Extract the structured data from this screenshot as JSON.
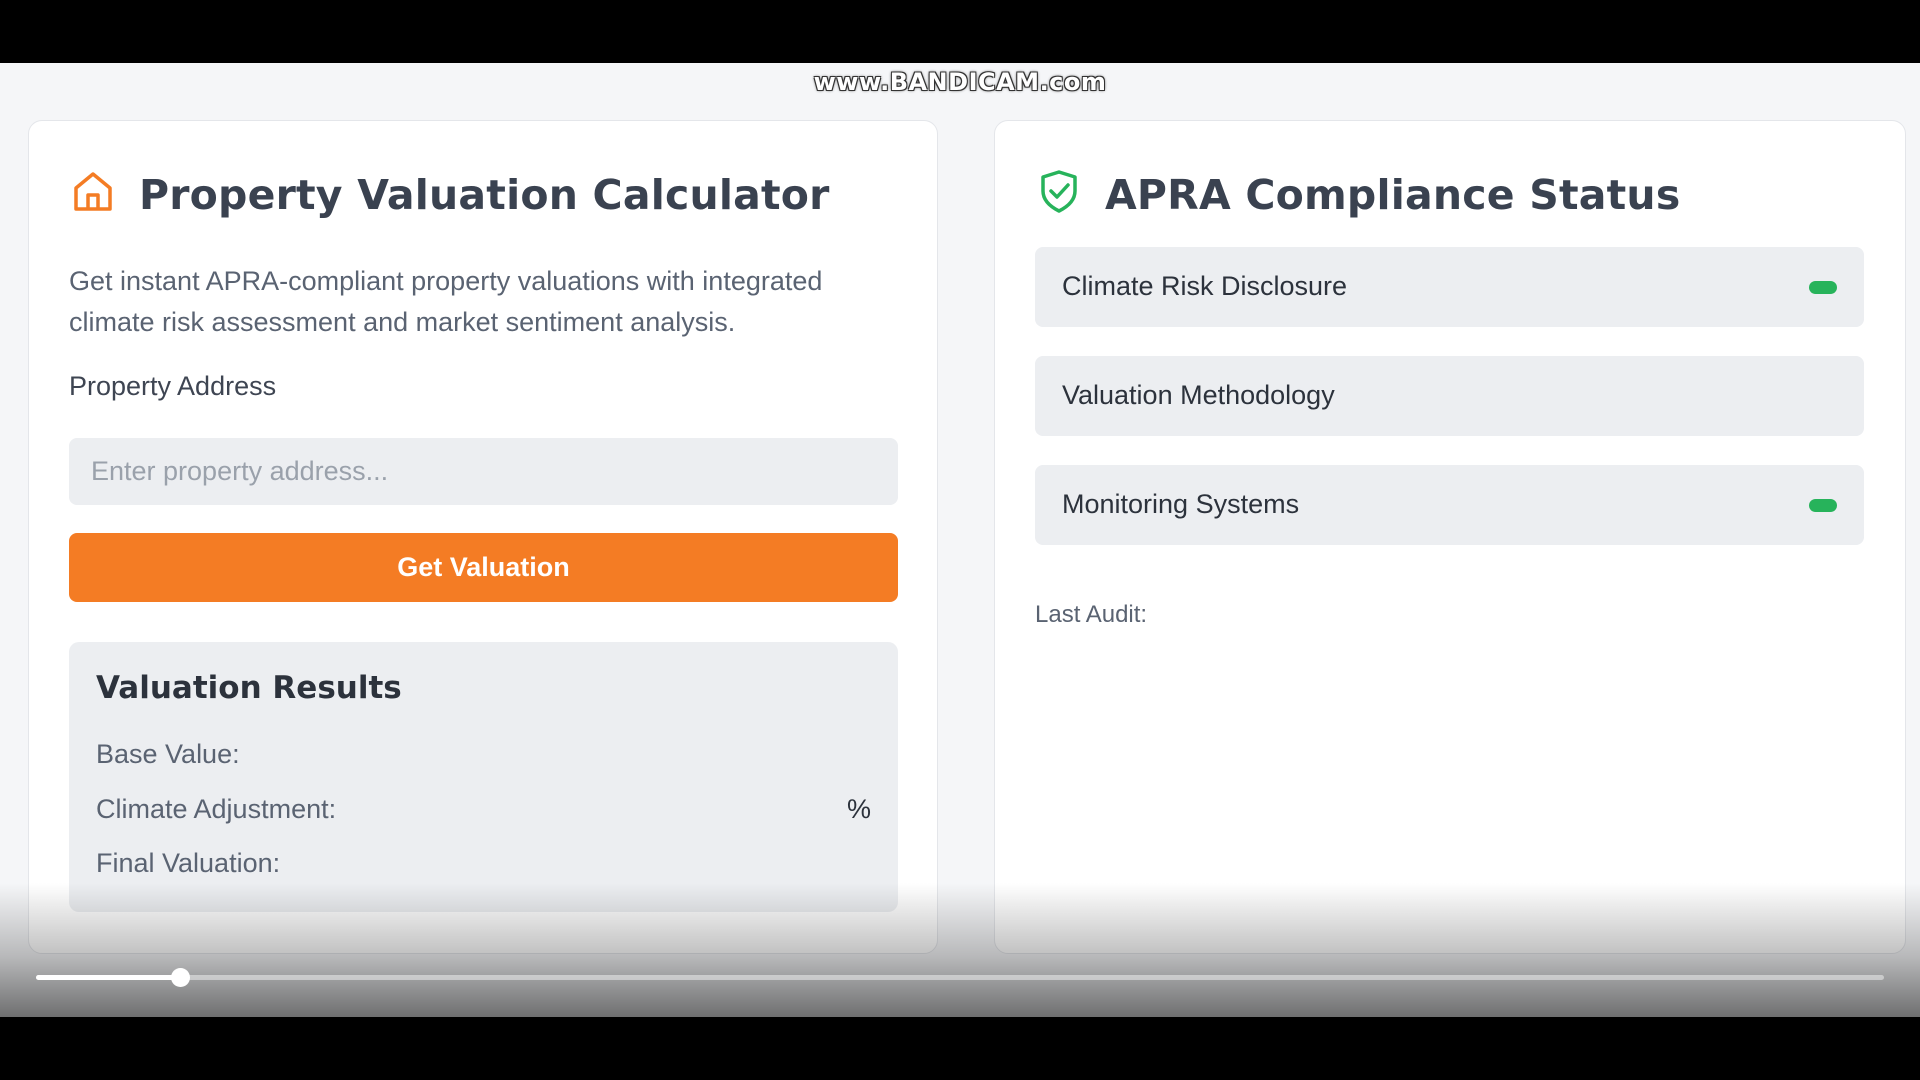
{
  "watermark": "www.BANDICAM.com",
  "valuation": {
    "title": "Property Valuation Calculator",
    "description": "Get instant APRA-compliant property valuations with integrated climate risk assessment and market sentiment analysis.",
    "address_label": "Property Address",
    "address_placeholder": "Enter property address...",
    "address_value": "",
    "button_label": "Get Valuation",
    "results": {
      "title": "Valuation Results",
      "base_value_label": "Base Value:",
      "base_value": "",
      "climate_adjustment_label": "Climate Adjustment:",
      "climate_adjustment_value": "%",
      "final_valuation_label": "Final Valuation:",
      "final_valuation_value": ""
    },
    "icon": "home-icon",
    "accent": "#f47c24"
  },
  "compliance": {
    "title": "APRA Compliance Status",
    "icon": "shield-check-icon",
    "items": [
      {
        "label": "Climate Risk Disclosure",
        "status_indicator": true
      },
      {
        "label": "Valuation Methodology",
        "status_indicator": false
      },
      {
        "label": "Monitoring Systems",
        "status_indicator": true
      }
    ],
    "status_color": "#27b35b",
    "last_audit_label": "Last Audit:"
  },
  "video": {
    "progress": 0.078
  }
}
